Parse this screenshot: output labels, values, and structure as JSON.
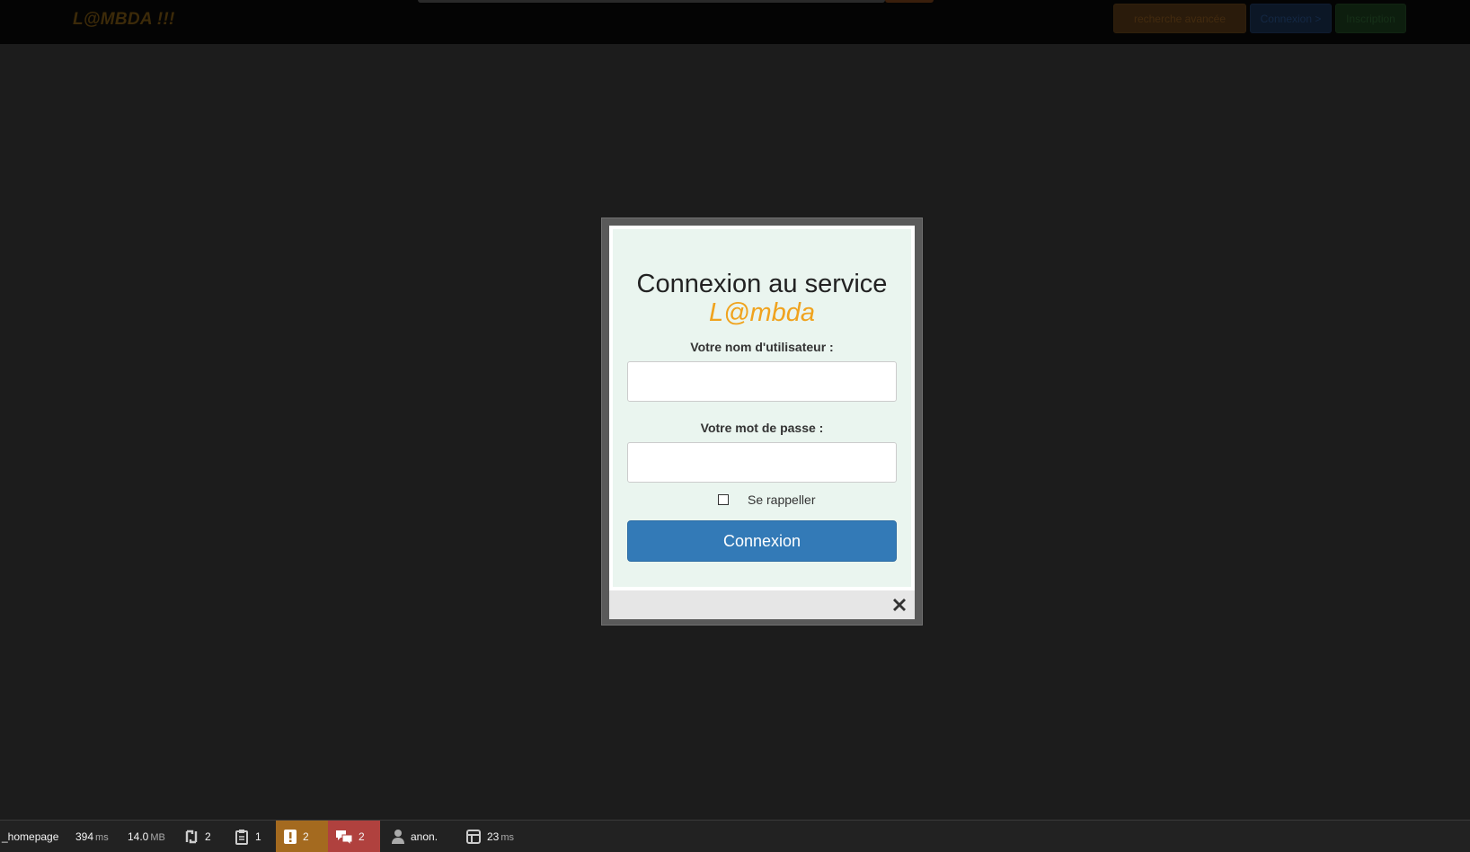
{
  "navbar": {
    "brand": "L@MBDA !!!",
    "advanced_search_label": "recherche avancée",
    "login_label": "Connexion >",
    "signup_label": "Inscription"
  },
  "modal": {
    "title": "Connexion au service",
    "brand": "L@mbda",
    "username_label": "Votre nom d'utilisateur :",
    "username_value": "",
    "password_label": "Votre mot de passe :",
    "password_value": "",
    "remember_label": "Se rappeller",
    "remember_checked": false,
    "submit_label": "Connexion",
    "close_icon": "close-icon"
  },
  "toolbar": {
    "route": "_homepage",
    "time_value": "394",
    "time_unit": "ms",
    "memory_value": "14.0",
    "memory_unit": "MB",
    "requests_count": "2",
    "forms_count": "1",
    "warnings_count": "2",
    "errors_count": "2",
    "user": "anon.",
    "db_time_value": "23",
    "db_time_unit": "ms",
    "colors": {
      "warning": "#a46a1f",
      "error": "#b0413e",
      "primary": "#337ab7",
      "brand": "#f0a31e"
    }
  }
}
